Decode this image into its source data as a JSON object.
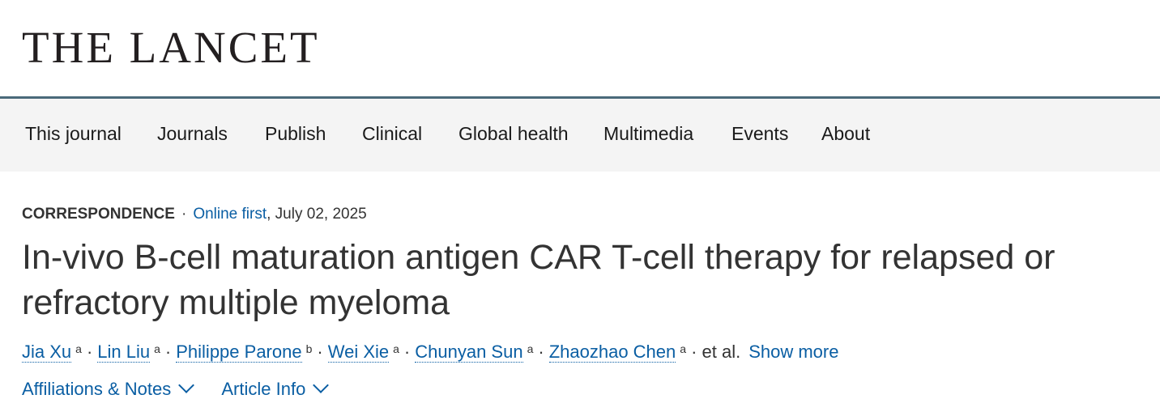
{
  "header": {
    "logo_text": "THE LANCET"
  },
  "nav": {
    "items": [
      {
        "label": "This journal"
      },
      {
        "label": "Journals"
      },
      {
        "label": "Publish"
      },
      {
        "label": "Clinical"
      },
      {
        "label": "Global health"
      },
      {
        "label": "Multimedia"
      },
      {
        "label": "Events"
      },
      {
        "label": "About"
      }
    ]
  },
  "article": {
    "type": "CORRESPONDENCE",
    "separator": "·",
    "online_first": "Online first",
    "date": ", July 02, 2025",
    "title": "In-vivo B-cell maturation antigen CAR T-cell therapy for relapsed or refractory multiple myeloma",
    "authors": [
      {
        "name": "Jia Xu",
        "aff": "a"
      },
      {
        "name": "Lin Liu",
        "aff": "a"
      },
      {
        "name": "Philippe Parone",
        "aff": "b"
      },
      {
        "name": "Wei Xie",
        "aff": "a"
      },
      {
        "name": "Chunyan Sun",
        "aff": "a"
      },
      {
        "name": "Zhaozhao Chen",
        "aff": "a"
      }
    ],
    "author_separator": "·",
    "et_al": "· et al.",
    "show_more": "Show more",
    "affiliations_toggle": "Affiliations & Notes",
    "article_info_toggle": "Article Info"
  },
  "colors": {
    "link": "#0a5ea3",
    "nav_background": "#f4f4f4",
    "nav_rule": "#4a6a7a"
  }
}
